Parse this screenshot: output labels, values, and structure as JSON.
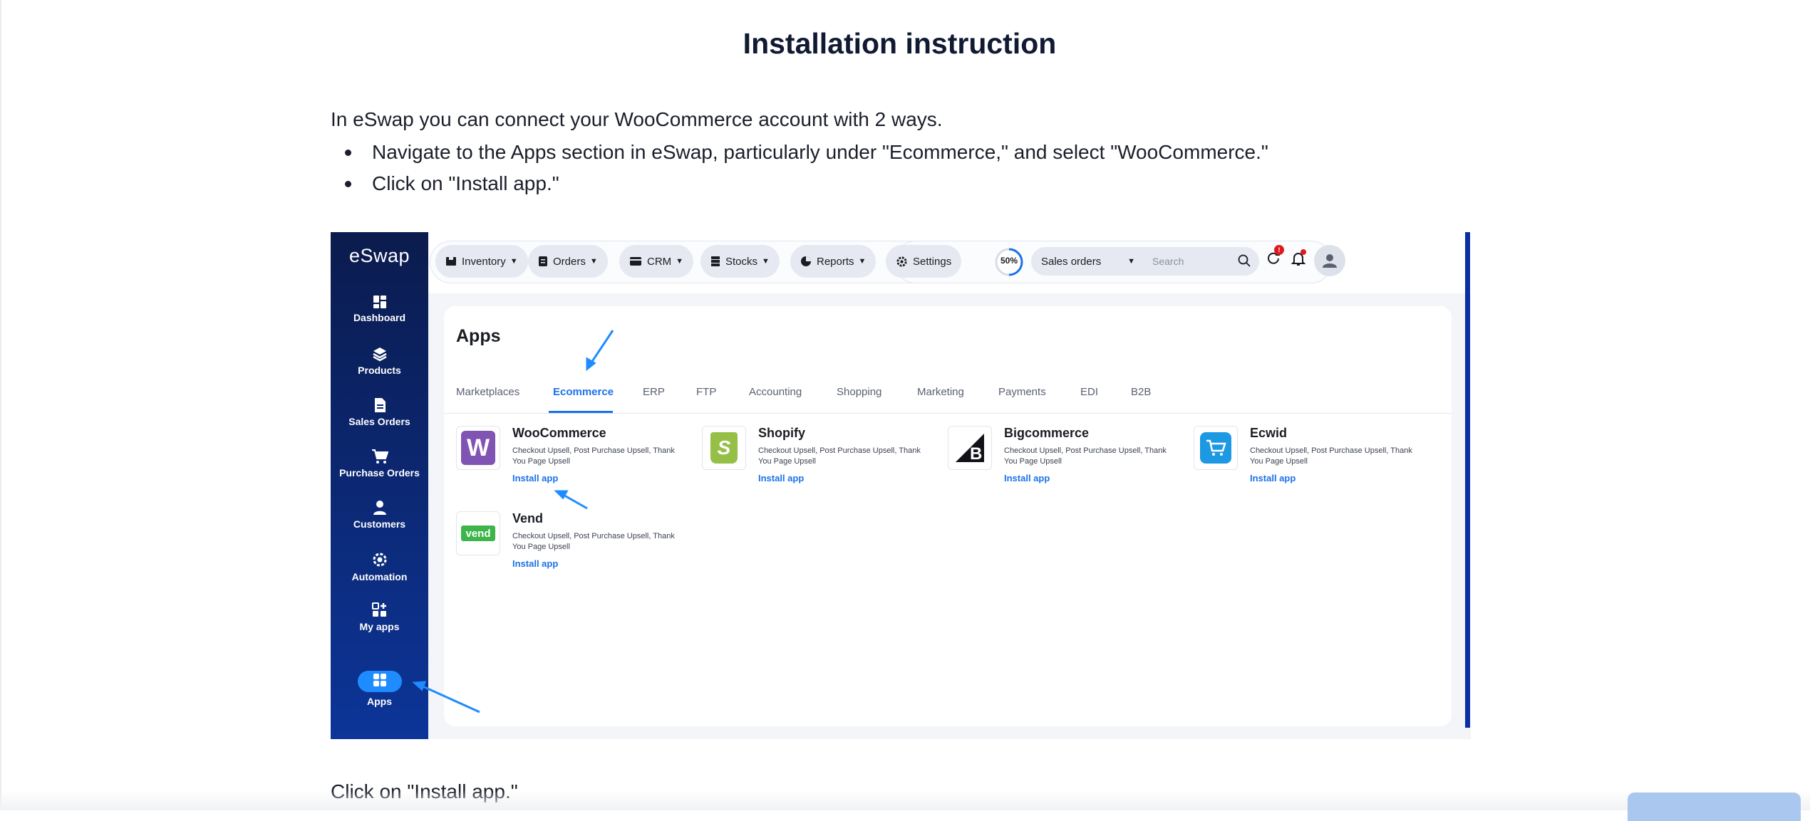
{
  "page": {
    "title": "Installation instruction",
    "intro": "In eSwap you can connect your WooCommerce account with 2 ways.",
    "bullets": [
      "Navigate to the Apps section in eSwap, particularly under \"Ecommerce,\" and select \"WooCommerce.\"",
      "Click on \"Install app.\""
    ],
    "after_image": "Click on \"Install app.\""
  },
  "screenshot": {
    "brand": "eSwap",
    "sidebar": [
      {
        "label": "Dashboard",
        "icon": "dashboard-icon"
      },
      {
        "label": "Products",
        "icon": "layers-icon"
      },
      {
        "label": "Sales Orders",
        "icon": "document-icon"
      },
      {
        "label": "Purchase Orders",
        "icon": "cart-icon"
      },
      {
        "label": "Customers",
        "icon": "person-icon"
      },
      {
        "label": "Automation",
        "icon": "gear-icon"
      },
      {
        "label": "My apps",
        "icon": "grid-plus-icon"
      },
      {
        "label": "Apps",
        "icon": "apps-grid-icon",
        "active": true
      }
    ],
    "topnav": [
      {
        "label": "Inventory",
        "icon": "box-icon"
      },
      {
        "label": "Orders",
        "icon": "clipboard-icon"
      },
      {
        "label": "CRM",
        "icon": "card-icon"
      },
      {
        "label": "Stocks",
        "icon": "stocks-icon"
      },
      {
        "label": "Reports",
        "icon": "pie-chart-icon"
      },
      {
        "label": "Settings",
        "icon": "gear-icon"
      }
    ],
    "progress": "50%",
    "progress_value": 0.5,
    "search_scope": "Sales orders",
    "search_placeholder": "Search",
    "notification_badge": "!",
    "apps_title": "Apps",
    "tabs": [
      "Marketplaces",
      "Ecommerce",
      "ERP",
      "FTP",
      "Accounting",
      "Shopping",
      "Marketing",
      "Payments",
      "EDI",
      "B2B"
    ],
    "active_tab": "Ecommerce",
    "apps": [
      {
        "name": "WooCommerce",
        "desc": "Checkout Upsell, Post Purchase Upsell, Thank You Page Upsell",
        "action": "Install app",
        "logo_text": "W",
        "logo_color": "#7f54b3"
      },
      {
        "name": "Shopify",
        "desc": "Checkout Upsell, Post Purchase Upsell, Thank You Page Upsell",
        "action": "Install app",
        "logo_text": "S",
        "logo_color": "#95bf47"
      },
      {
        "name": "Bigcommerce",
        "desc": "Checkout Upsell, Post Purchase Upsell, Thank You Page Upsell",
        "action": "Install app",
        "logo_text": "B",
        "logo_color": "#121118"
      },
      {
        "name": "Ecwid",
        "desc": "Checkout Upsell, Post Purchase Upsell, Thank You Page Upsell",
        "action": "Install app",
        "logo_text": "",
        "logo_color": "#1d98e2"
      },
      {
        "name": "Vend",
        "desc": "Checkout Upsell, Post Purchase Upsell, Thank You Page Upsell",
        "action": "Install app",
        "logo_text": "vend",
        "logo_color": "#3db54a"
      }
    ]
  },
  "colors": {
    "accent": "#1a72e8",
    "sidebar_top": "#0b1b4d",
    "sidebar_bottom": "#0c3599",
    "annotation_arrow": "#1e8cff"
  }
}
